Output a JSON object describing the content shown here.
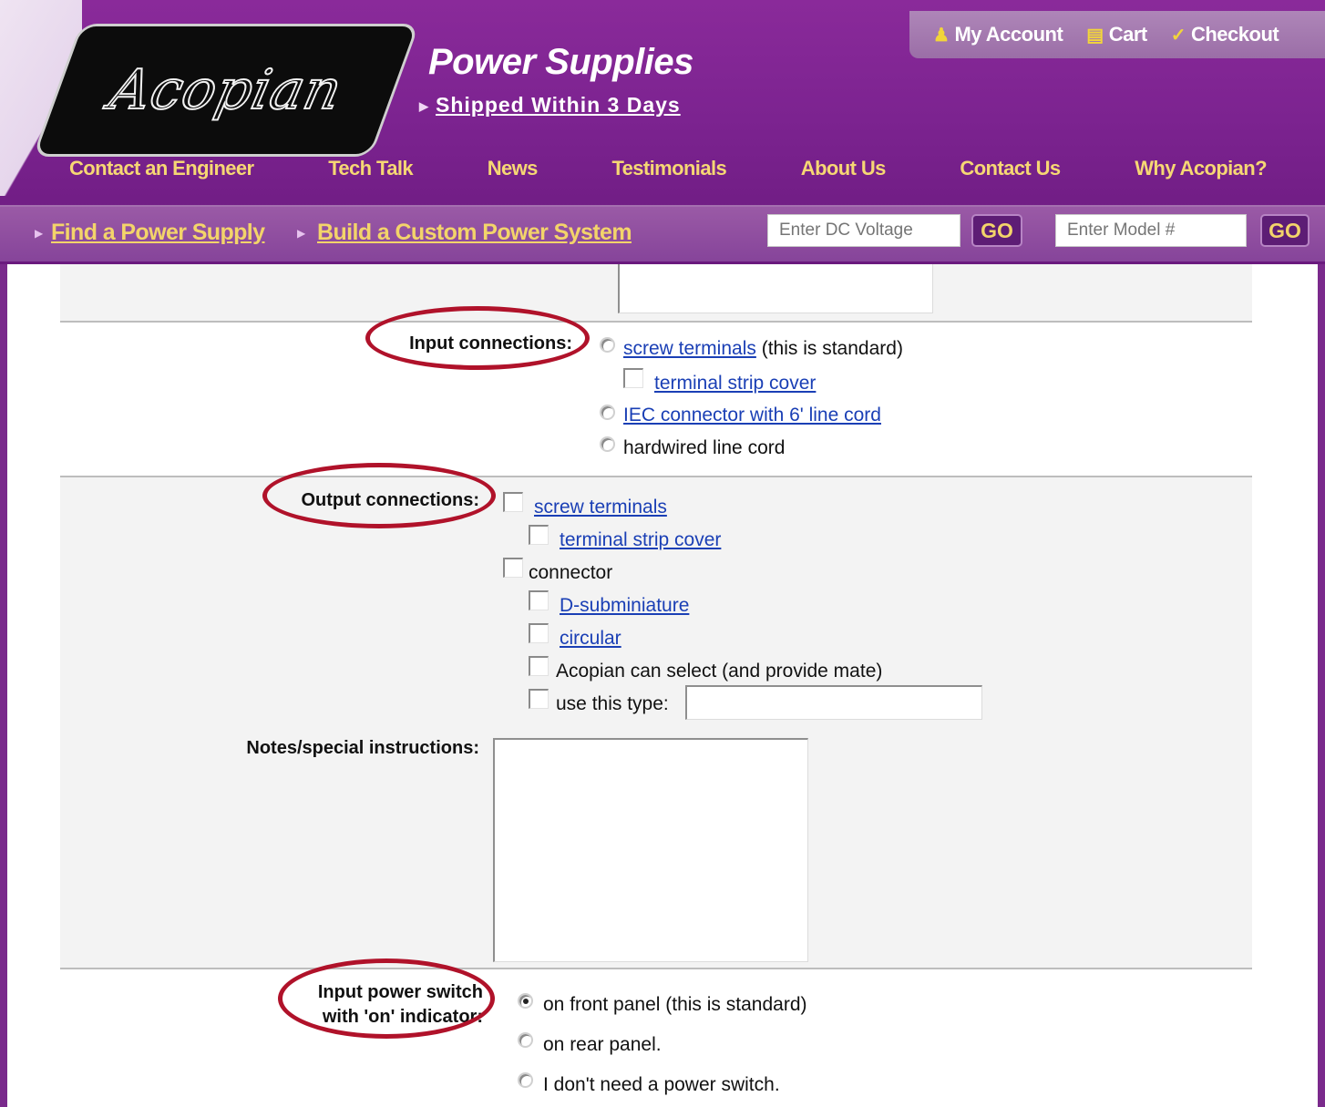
{
  "header": {
    "logo_text": "Acopian",
    "title": "Power Supplies",
    "subtitle": "Shipped Within 3 Days",
    "account_links": [
      {
        "label": "My Account",
        "icon": "user-icon"
      },
      {
        "label": "Cart",
        "icon": "cart-icon"
      },
      {
        "label": "Checkout",
        "icon": "check-icon"
      }
    ],
    "nav": [
      "Contact an Engineer",
      "Tech Talk",
      "News",
      "Testimonials",
      "About Us",
      "Contact Us",
      "Why Acopian?"
    ],
    "subnav": [
      "Find a Power Supply",
      "Build a Custom Power System"
    ],
    "search_voltage_placeholder": "Enter DC Voltage",
    "search_model_placeholder": "Enter Model #",
    "go_label": "GO"
  },
  "form": {
    "input_connections": {
      "label": "Input connections:",
      "options": {
        "screw_terminals": "screw terminals",
        "screw_terminals_note": "(this is standard)",
        "terminal_strip_cover": "terminal strip cover",
        "iec_connector": "IEC connector with 6' line cord",
        "hardwired": "hardwired line cord"
      }
    },
    "output_connections": {
      "label": "Output connections:",
      "options": {
        "screw_terminals": "screw terminals",
        "terminal_strip_cover": "terminal strip cover",
        "connector": "connector",
        "d_subminiature": "D-subminiature",
        "circular": "circular",
        "acopian_select": "Acopian can select (and provide mate)",
        "use_this_type": "use this type:"
      }
    },
    "notes": {
      "label": "Notes/special instructions:"
    },
    "power_switch": {
      "label_line1": "Input power switch",
      "label_line2": "with 'on' indicator:",
      "options": {
        "front_panel": "on front panel (this is standard)",
        "rear_panel": "on rear panel.",
        "none": "I don't need a power switch."
      },
      "selected": "front_panel"
    }
  },
  "colors": {
    "header_purple": "#7c2390",
    "nav_gold": "#f6d774",
    "link_blue": "#1a3fb5",
    "highlight_red": "#b0122a"
  }
}
